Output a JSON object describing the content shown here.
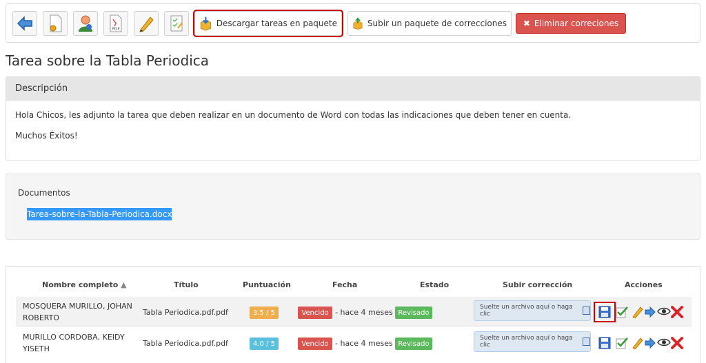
{
  "toolbar": {
    "download_label": "Descargar tareas en paquete",
    "upload_label": "Subir un paquete de correcciones",
    "delete_label": "Eliminar correciones",
    "pdf_text": "PDF"
  },
  "page": {
    "title": "Tarea sobre la Tabla Periodica"
  },
  "description": {
    "heading": "Descripción",
    "line1": "Hola Chicos, les adjunto la tarea que deben realizar en un documento de Word con todas las indicaciones que deben tener en cuenta.",
    "line2": "Muchos Éxitos!"
  },
  "documents": {
    "label": "Documentos",
    "file": "Tarea-sobre-la-Tabla-Periodica.docx"
  },
  "table": {
    "headers": {
      "name": "Nombre completo",
      "title": "Título",
      "score": "Puntuación",
      "date": "Fecha",
      "state": "Estado",
      "upload": "Subir corrección",
      "actions": "Acciones"
    },
    "rows": [
      {
        "name1": "MOSQUERA MURILLO, JOHAN",
        "name2": "ROBERTO",
        "title": "Tabla Periodica.pdf.pdf",
        "score": "3.5 / 5",
        "due": "Vencido",
        "ago": "- hace 4 meses",
        "state": "Revisado",
        "drop": "Suelte un archivo aquí o haga clic"
      },
      {
        "name1": "MURILLO CORDOBA, KEIDY",
        "name2": "YISETH",
        "title": "Tabla Periodica.pdf.pdf",
        "score": "4.0 / 5",
        "due": "Vencido",
        "ago": "- hace 4 meses",
        "state": "Revisado",
        "drop": "Suelte un archivo aquí o haga clic"
      }
    ]
  },
  "icons": [
    "back-arrow-icon",
    "settings-document-icon",
    "user-icon",
    "pdf-icon",
    "pencil-icon",
    "checklist-icon",
    "download-package-icon",
    "upload-package-icon",
    "save-icon",
    "check-icon",
    "edit-icon",
    "forward-icon",
    "eye-icon",
    "delete-icon"
  ],
  "colors": {
    "danger": "#d9534f",
    "highlight": "#cc0000",
    "selection": "#3399ff",
    "warning": "#f0ad4e",
    "info": "#5bc0de",
    "success": "#5cb85c"
  }
}
